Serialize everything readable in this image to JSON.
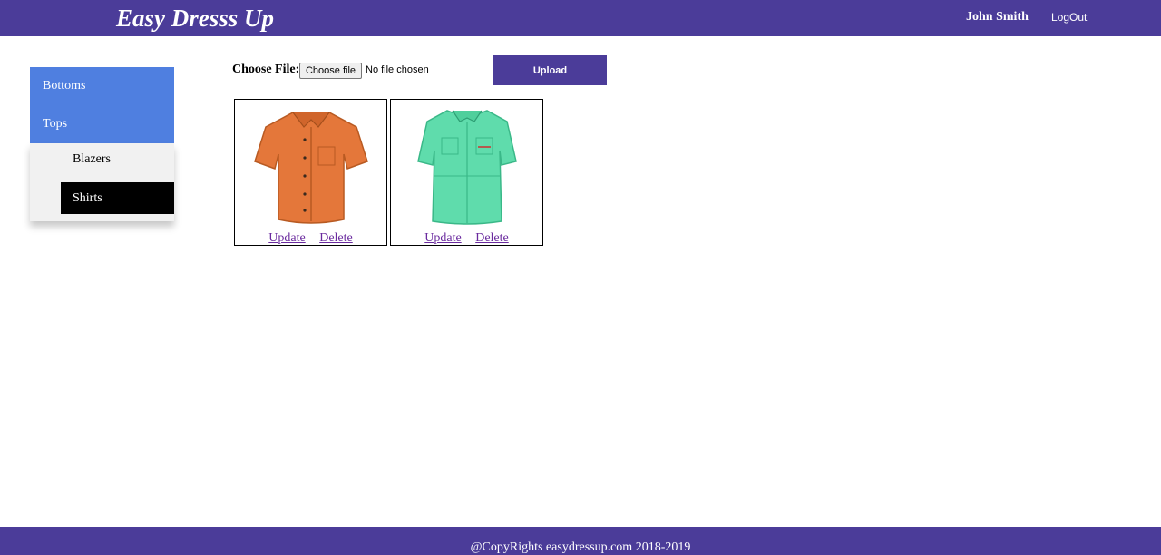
{
  "header": {
    "brand": "Easy Dresss Up",
    "user_name": "John Smith",
    "logout_label": "LogOut"
  },
  "sidebar": {
    "categories": [
      {
        "label": "Bottoms"
      },
      {
        "label": "Tops"
      }
    ],
    "submenu": [
      {
        "label": "Blazers"
      },
      {
        "label": "Shirts",
        "selected": true
      }
    ]
  },
  "upload": {
    "label": "Choose File:",
    "file_button_label": "Choose file",
    "file_status": "No file chosen",
    "upload_button_label": "Upload"
  },
  "items": [
    {
      "image": "orange-shirt",
      "color": "#e4773a",
      "update_label": "Update",
      "delete_label": "Delete"
    },
    {
      "image": "mint-shirt",
      "color": "#5fdcac",
      "update_label": "Update",
      "delete_label": "Delete"
    }
  ],
  "footer": {
    "text": "@CopyRights easydressup.com 2018-2019"
  },
  "colors": {
    "brand": "#4b3c99",
    "category_bg": "#4f7fe0",
    "selected_bg": "#000000",
    "link": "#6a2a9e"
  }
}
